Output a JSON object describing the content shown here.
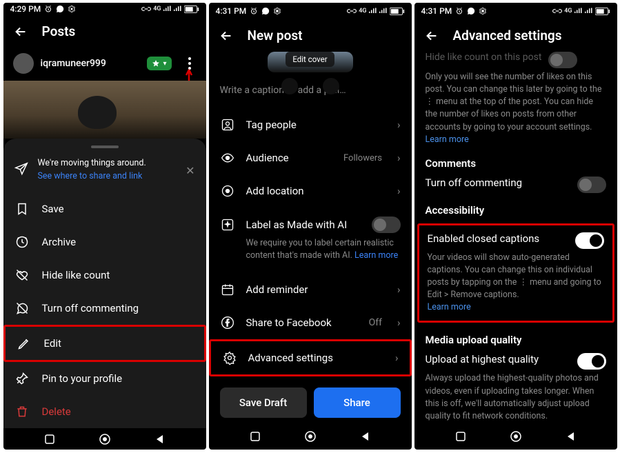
{
  "status": {
    "time1": "4:29 PM",
    "time2": "4:31 PM",
    "time3": "4:31 PM"
  },
  "s1": {
    "title": "Posts",
    "username": "iqramuneer999",
    "banner_text": "We're moving things around.",
    "banner_link": "See where to share and link",
    "menu": {
      "save": "Save",
      "archive": "Archive",
      "hide_like": "Hide like count",
      "turn_off_comment": "Turn off commenting",
      "edit": "Edit",
      "pin": "Pin to your profile",
      "delete": "Delete"
    }
  },
  "s2": {
    "title": "New post",
    "edit_cover": "Edit cover",
    "caption_placeholder": "Write a caption or add a poll…",
    "tag_people": "Tag people",
    "audience": "Audience",
    "audience_value": "Followers",
    "add_location": "Add location",
    "ai_label": "Label as Made with AI",
    "ai_desc": "We require you to label certain realistic content that's made with AI. ",
    "ai_learn": "Learn more",
    "add_reminder": "Add reminder",
    "share_fb": "Share to Facebook",
    "share_fb_value": "Off",
    "advanced": "Advanced settings",
    "save_draft": "Save Draft",
    "share": "Share"
  },
  "s3": {
    "title": "Advanced settings",
    "hide_like_title": "Hide like count on this post",
    "hide_like_desc": "Only you will see the number of likes on this post. You can change this later by going to the ⋮ menu at the top of the post. You can hide the number of likes on posts from other accounts by going to your account settings. ",
    "hide_like_lm": "Learn more",
    "comments_title": "Comments",
    "turn_off_comment": "Turn off commenting",
    "accessibility_title": "Accessibility",
    "cc_title": "Enabled closed captions",
    "cc_desc": "Your videos will show auto-generated captions. You can change this on individual posts by tapping on the ⋮ menu and going to Edit > Remove captions. ",
    "cc_lm": "Learn more",
    "media_quality_title": "Media upload quality",
    "hq_title": "Upload at highest quality",
    "hq_desc": "Always upload the highest-quality photos and videos, even if uploading takes longer. When this is off, we'll automatically adjust upload quality to fit network conditions."
  }
}
